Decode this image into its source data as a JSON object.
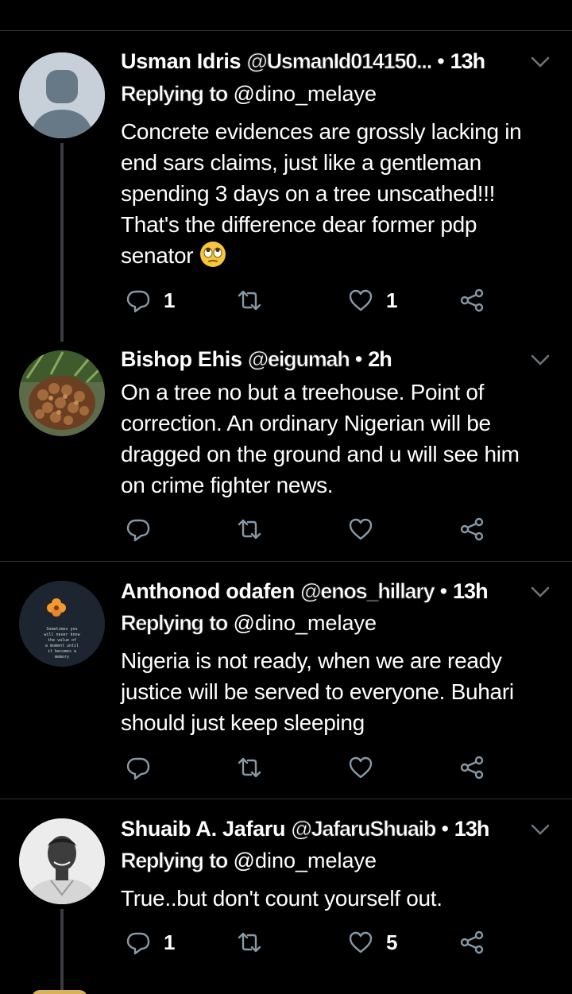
{
  "tweets": [
    {
      "name": "Usman Idris",
      "handle": "@UsmanId014150...",
      "time": "13h",
      "reply_prefix": "Replying",
      "reply_to_word": "to",
      "reply_target": "@dino_melaye",
      "lines": [
        "Concrete evidences are grossly lacking in",
        "end sars claims,  just like a gentleman",
        "spending 3 days on a tree unscathed!!!",
        "That's the difference dear former pdp",
        "senator"
      ],
      "replies": "1",
      "retweets": "",
      "likes": "1",
      "emoji_icon": "eye-roll-emoji-icon"
    },
    {
      "name": "Bishop Ehis",
      "handle": "@eigumah",
      "time": "2h",
      "lines": [
        "On a tree no but a treehouse. Point of",
        "correction. An ordinary Nigerian will be",
        "dragged on the ground and u will see him",
        "on crime fighter news."
      ],
      "replies": "",
      "retweets": "",
      "likes": ""
    },
    {
      "name": "Anthonod odafen",
      "handle": "@enos_hillary",
      "time": "13h",
      "reply_prefix": "Replying",
      "reply_to_word": "to",
      "reply_target": "@dino_melaye",
      "lines": [
        "Nigeria is not ready, when we are ready",
        "justice will be served to everyone.  Buhari",
        "should just keep sleeping"
      ],
      "avatar_text": "Sometimes you will never know the value of a moment until it becomes a memory",
      "replies": "",
      "retweets": "",
      "likes": ""
    },
    {
      "name": "Shuaib A. Jafaru",
      "handle": "@JafaruShuaib",
      "time": "13h",
      "reply_prefix": "Replying",
      "reply_to_word": "to",
      "reply_target": "@dino_melaye",
      "lines": [
        "True..but don't count yourself out."
      ],
      "replies": "1",
      "retweets": "",
      "likes": "5"
    }
  ],
  "separator": "•",
  "colors": {
    "background": "#000000",
    "text": "#ffffff",
    "icon": "#8899a6",
    "divider": "#2f3336",
    "thread_line": "#3a3d40"
  },
  "icons": [
    "reply-icon",
    "retweet-icon",
    "like-icon",
    "share-icon",
    "chevron-down-icon"
  ]
}
